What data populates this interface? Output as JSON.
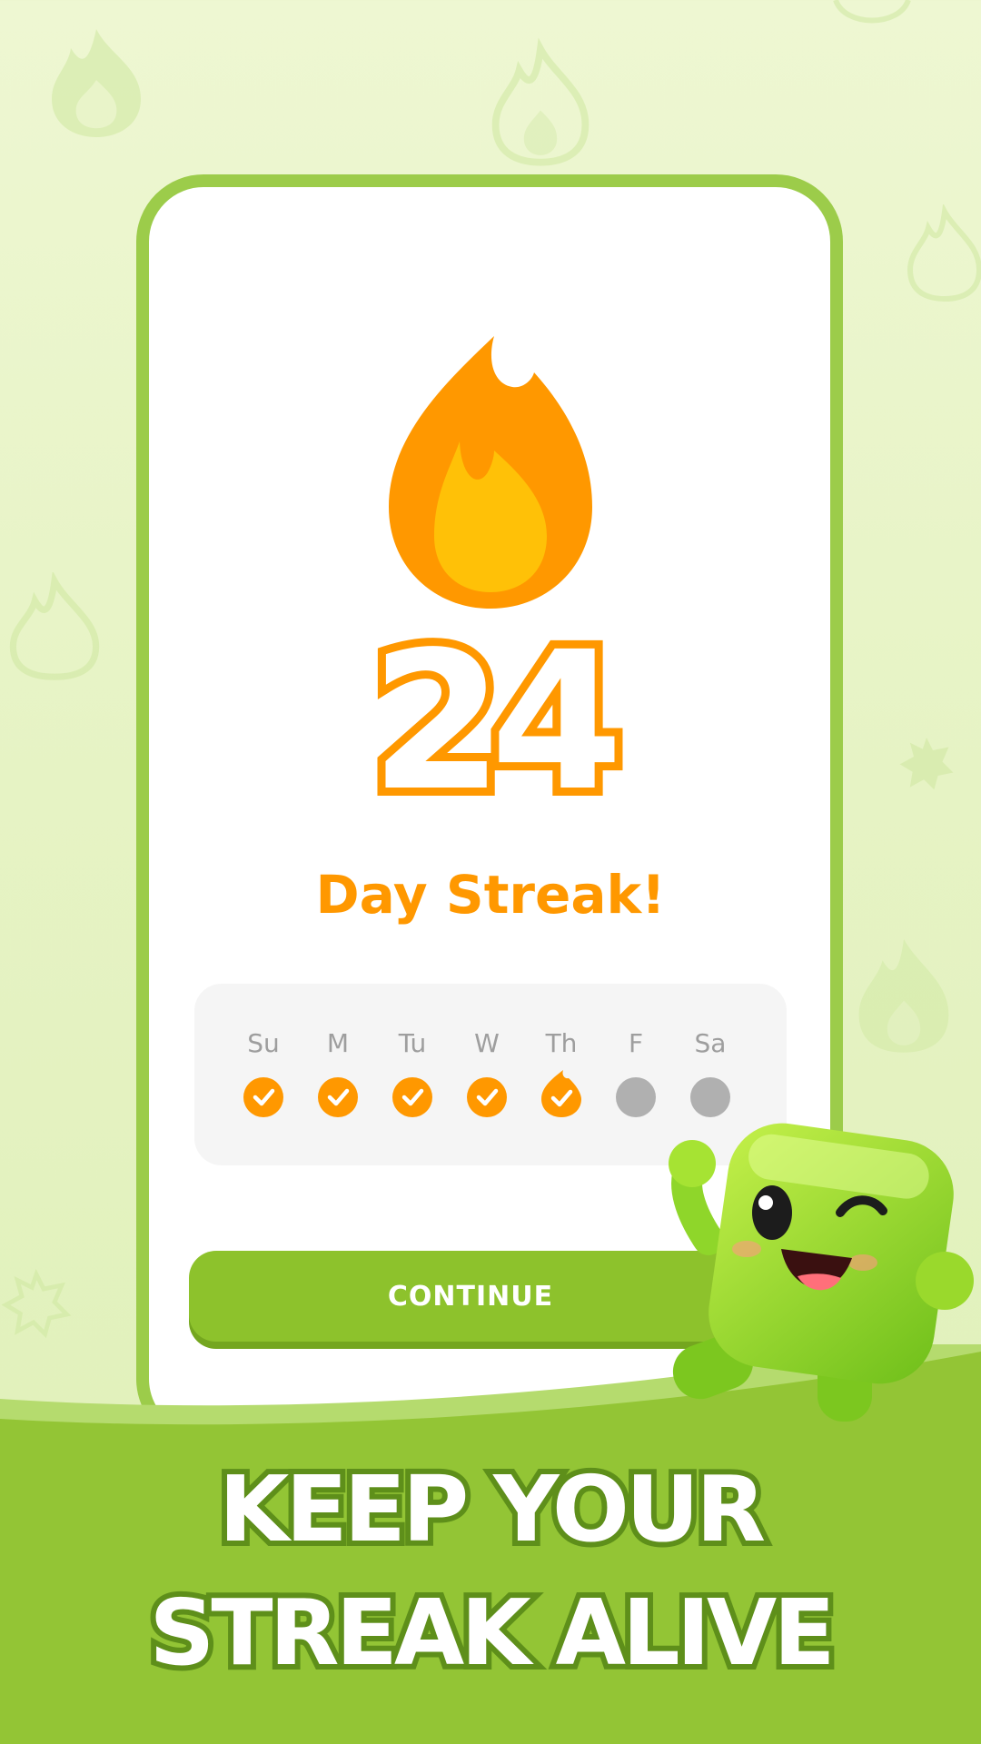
{
  "streak": {
    "count": "24",
    "label": "Day Streak!"
  },
  "week": {
    "days": [
      {
        "label": "Su",
        "status": "done"
      },
      {
        "label": "M",
        "status": "done"
      },
      {
        "label": "Tu",
        "status": "done"
      },
      {
        "label": "W",
        "status": "done"
      },
      {
        "label": "Th",
        "status": "today-done"
      },
      {
        "label": "F",
        "status": "pending"
      },
      {
        "label": "Sa",
        "status": "pending"
      }
    ]
  },
  "continue_button": {
    "label": "CONTINUE"
  },
  "tagline": {
    "line1": "KEEP YOUR",
    "line2": "STREAK ALIVE"
  },
  "colors": {
    "accent": "#ff9800",
    "flame_inner": "#ffc107",
    "brand_green": "#8dc22c",
    "background": "#e6f3c4",
    "pending_dot": "#b0b0b0"
  },
  "icons": {
    "hero": "flame-icon",
    "check": "check-icon",
    "mascot": "green-cube-mascot"
  }
}
